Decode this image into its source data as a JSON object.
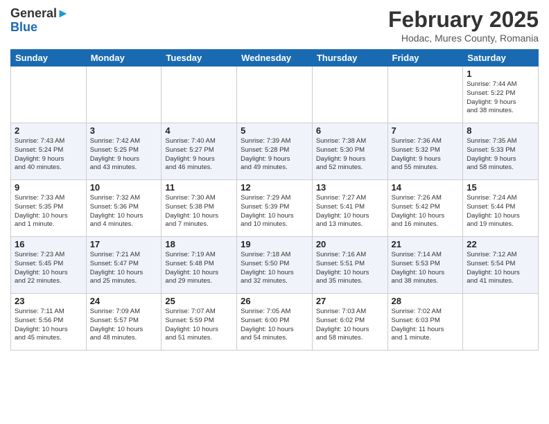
{
  "header": {
    "logo_general": "General",
    "logo_blue": "Blue",
    "month_title": "February 2025",
    "subtitle": "Hodac, Mures County, Romania"
  },
  "days_of_week": [
    "Sunday",
    "Monday",
    "Tuesday",
    "Wednesday",
    "Thursday",
    "Friday",
    "Saturday"
  ],
  "weeks": [
    [
      {
        "day": "",
        "info": ""
      },
      {
        "day": "",
        "info": ""
      },
      {
        "day": "",
        "info": ""
      },
      {
        "day": "",
        "info": ""
      },
      {
        "day": "",
        "info": ""
      },
      {
        "day": "",
        "info": ""
      },
      {
        "day": "1",
        "info": "Sunrise: 7:44 AM\nSunset: 5:22 PM\nDaylight: 9 hours\nand 38 minutes."
      }
    ],
    [
      {
        "day": "2",
        "info": "Sunrise: 7:43 AM\nSunset: 5:24 PM\nDaylight: 9 hours\nand 40 minutes."
      },
      {
        "day": "3",
        "info": "Sunrise: 7:42 AM\nSunset: 5:25 PM\nDaylight: 9 hours\nand 43 minutes."
      },
      {
        "day": "4",
        "info": "Sunrise: 7:40 AM\nSunset: 5:27 PM\nDaylight: 9 hours\nand 46 minutes."
      },
      {
        "day": "5",
        "info": "Sunrise: 7:39 AM\nSunset: 5:28 PM\nDaylight: 9 hours\nand 49 minutes."
      },
      {
        "day": "6",
        "info": "Sunrise: 7:38 AM\nSunset: 5:30 PM\nDaylight: 9 hours\nand 52 minutes."
      },
      {
        "day": "7",
        "info": "Sunrise: 7:36 AM\nSunset: 5:32 PM\nDaylight: 9 hours\nand 55 minutes."
      },
      {
        "day": "8",
        "info": "Sunrise: 7:35 AM\nSunset: 5:33 PM\nDaylight: 9 hours\nand 58 minutes."
      }
    ],
    [
      {
        "day": "9",
        "info": "Sunrise: 7:33 AM\nSunset: 5:35 PM\nDaylight: 10 hours\nand 1 minute."
      },
      {
        "day": "10",
        "info": "Sunrise: 7:32 AM\nSunset: 5:36 PM\nDaylight: 10 hours\nand 4 minutes."
      },
      {
        "day": "11",
        "info": "Sunrise: 7:30 AM\nSunset: 5:38 PM\nDaylight: 10 hours\nand 7 minutes."
      },
      {
        "day": "12",
        "info": "Sunrise: 7:29 AM\nSunset: 5:39 PM\nDaylight: 10 hours\nand 10 minutes."
      },
      {
        "day": "13",
        "info": "Sunrise: 7:27 AM\nSunset: 5:41 PM\nDaylight: 10 hours\nand 13 minutes."
      },
      {
        "day": "14",
        "info": "Sunrise: 7:26 AM\nSunset: 5:42 PM\nDaylight: 10 hours\nand 16 minutes."
      },
      {
        "day": "15",
        "info": "Sunrise: 7:24 AM\nSunset: 5:44 PM\nDaylight: 10 hours\nand 19 minutes."
      }
    ],
    [
      {
        "day": "16",
        "info": "Sunrise: 7:23 AM\nSunset: 5:45 PM\nDaylight: 10 hours\nand 22 minutes."
      },
      {
        "day": "17",
        "info": "Sunrise: 7:21 AM\nSunset: 5:47 PM\nDaylight: 10 hours\nand 25 minutes."
      },
      {
        "day": "18",
        "info": "Sunrise: 7:19 AM\nSunset: 5:48 PM\nDaylight: 10 hours\nand 29 minutes."
      },
      {
        "day": "19",
        "info": "Sunrise: 7:18 AM\nSunset: 5:50 PM\nDaylight: 10 hours\nand 32 minutes."
      },
      {
        "day": "20",
        "info": "Sunrise: 7:16 AM\nSunset: 5:51 PM\nDaylight: 10 hours\nand 35 minutes."
      },
      {
        "day": "21",
        "info": "Sunrise: 7:14 AM\nSunset: 5:53 PM\nDaylight: 10 hours\nand 38 minutes."
      },
      {
        "day": "22",
        "info": "Sunrise: 7:12 AM\nSunset: 5:54 PM\nDaylight: 10 hours\nand 41 minutes."
      }
    ],
    [
      {
        "day": "23",
        "info": "Sunrise: 7:11 AM\nSunset: 5:56 PM\nDaylight: 10 hours\nand 45 minutes."
      },
      {
        "day": "24",
        "info": "Sunrise: 7:09 AM\nSunset: 5:57 PM\nDaylight: 10 hours\nand 48 minutes."
      },
      {
        "day": "25",
        "info": "Sunrise: 7:07 AM\nSunset: 5:59 PM\nDaylight: 10 hours\nand 51 minutes."
      },
      {
        "day": "26",
        "info": "Sunrise: 7:05 AM\nSunset: 6:00 PM\nDaylight: 10 hours\nand 54 minutes."
      },
      {
        "day": "27",
        "info": "Sunrise: 7:03 AM\nSunset: 6:02 PM\nDaylight: 10 hours\nand 58 minutes."
      },
      {
        "day": "28",
        "info": "Sunrise: 7:02 AM\nSunset: 6:03 PM\nDaylight: 11 hours\nand 1 minute."
      },
      {
        "day": "",
        "info": ""
      }
    ]
  ]
}
